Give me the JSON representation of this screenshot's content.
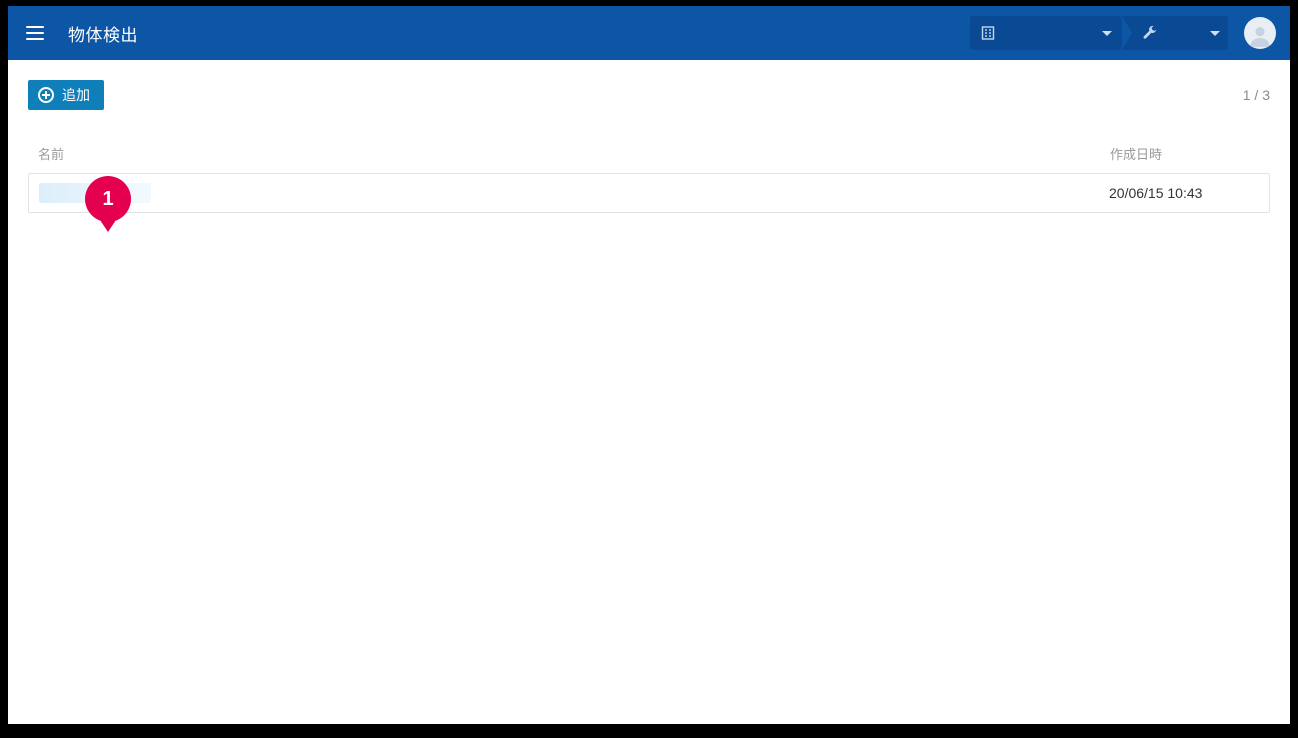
{
  "header": {
    "title": "物体検出"
  },
  "toolbar": {
    "add_label": "追加",
    "pager": "1 / 3"
  },
  "table": {
    "headers": {
      "name": "名前",
      "created": "作成日時"
    },
    "rows": [
      {
        "created": "20/06/15 10:43"
      }
    ]
  },
  "annotation": {
    "pin1": "1"
  }
}
